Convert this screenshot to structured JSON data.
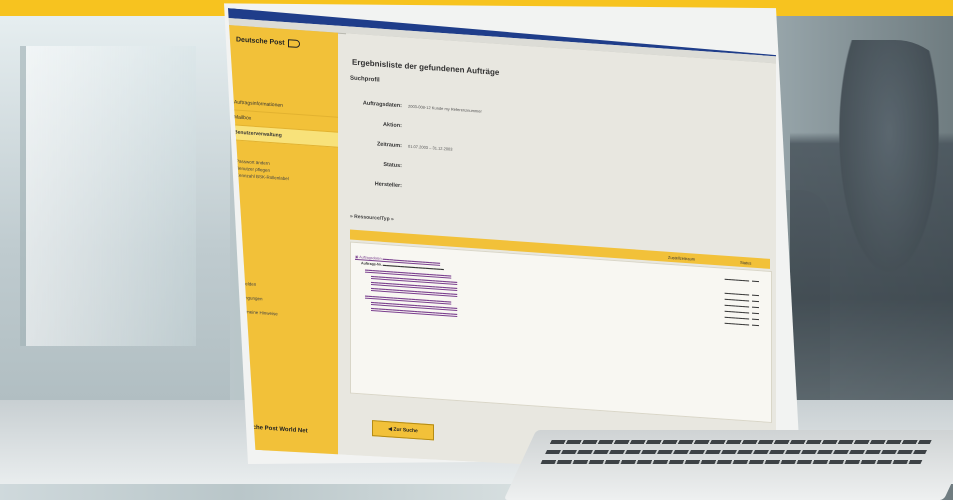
{
  "sidebar": {
    "logo": "Deutsche Post",
    "nav": [
      "Auftragsinformationen",
      "Mailbox",
      "Benutzerverwaltung"
    ],
    "subnav": [
      "Passwort ändern",
      "Benutzer pflegen",
      "Kennzahl BSK-Rollenlabel"
    ],
    "subnav2": [
      "Abmelden",
      "",
      "Bedingungen",
      "Hilfe",
      "Allgemeine Hinweise"
    ],
    "footer": "Deutsche Post",
    "footer_brand": "World Net"
  },
  "content": {
    "page_title": "Ergebnisliste der gefundenen Aufträge",
    "section_title": "Suchprofil",
    "fields": [
      {
        "label": "Auftragsdaten:",
        "value": "2003-008-12 Kunde my Referenznummer"
      },
      {
        "label": "Aktion:",
        "value": ""
      },
      {
        "label": "Zeitraum:",
        "value": "01.07.2003 – 31.12.2003"
      },
      {
        "label": "Status:",
        "value": ""
      },
      {
        "label": "Hersteller:",
        "value": ""
      }
    ],
    "more": "» Ressource/Typ »",
    "result_header": {
      "col1": "Zustellzeitraum",
      "col2": "Status"
    },
    "back_button": "Zur Suche"
  }
}
